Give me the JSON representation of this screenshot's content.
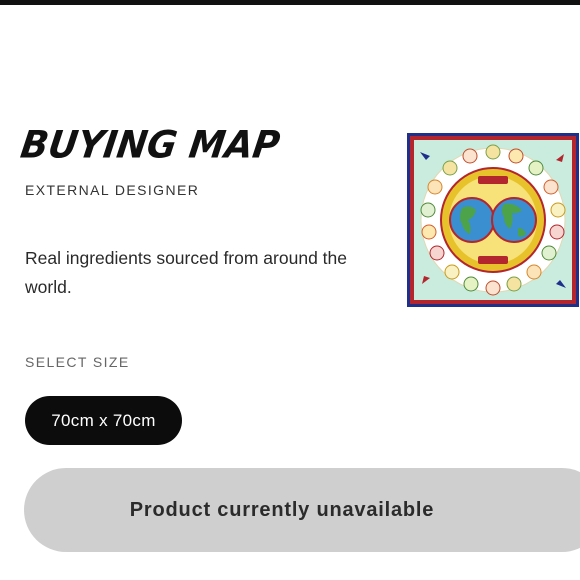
{
  "product": {
    "title": "BUYING MAP",
    "designer": "EXTERNAL DESIGNER",
    "description": "Real ingredients sourced from around the world.",
    "image_alt": "buying-map-scarf-image"
  },
  "size_selector": {
    "label": "SELECT SIZE",
    "options": [
      "70cm x 70cm"
    ],
    "selected": "70cm x 70cm"
  },
  "purchase": {
    "button_label": "Product currently unavailable"
  },
  "colors": {
    "top_bar": "#111111",
    "size_pill_bg": "#0c0c0c",
    "unavailable_bg": "#cfcfcf",
    "scarf_border": "#b3262e",
    "scarf_bg": "#c9ecdf",
    "globe_ocean": "#3a8fd0",
    "globe_land": "#4ca34a",
    "globe_ring": "#e8c22a"
  }
}
